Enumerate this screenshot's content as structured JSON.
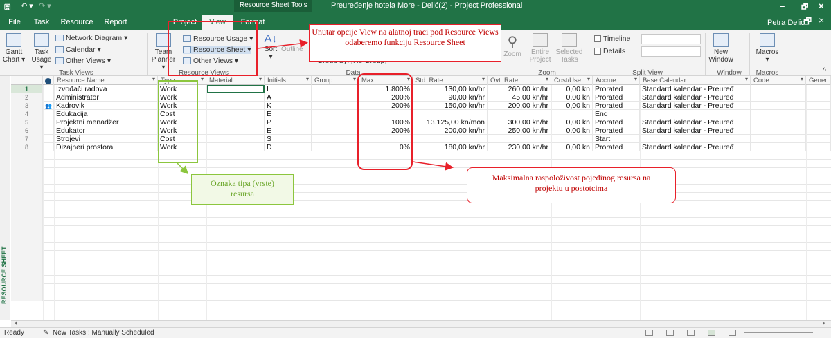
{
  "titlebar": {
    "context_tab": "Resource Sheet Tools",
    "title": "Preuređenje hotela More - Delić(2) - Project Professional",
    "minimize": "–",
    "restore": "🗗",
    "close": "×"
  },
  "tabs": [
    "File",
    "Task",
    "Resource",
    "Report",
    "Project",
    "View",
    "Format"
  ],
  "active_tab": "View",
  "user": "Petra Delic",
  "ribbon": {
    "task_views": {
      "gantt": "Gantt Chart",
      "task_usage": "Task Usage",
      "network_diagram": "Network Diagram",
      "calendar": "Calendar",
      "other_views": "Other Views",
      "label": "Task Views"
    },
    "resource_views": {
      "team_planner": "Team Planner",
      "resource_usage": "Resource Usage",
      "resource_sheet": "Resource Sheet",
      "other_views": "Other Views",
      "label": "Resource Views"
    },
    "data": {
      "sort": "Sort",
      "outline": "Outline",
      "group_by": "Group by: [No Group]",
      "label": "Data"
    },
    "zoom": {
      "zoom": "Zoom",
      "entire_project": "Entire Project",
      "selected_tasks": "Selected Tasks",
      "label": "Zoom"
    },
    "split_view": {
      "timeline": "Timeline",
      "details": "Details",
      "label": "Split View"
    },
    "window": {
      "new_window": "New Window",
      "label": "Window"
    },
    "macros": {
      "macros": "Macros",
      "label": "Macros"
    }
  },
  "side_label": "RESOURCE SHEET",
  "columns": [
    "Resource Name",
    "Type",
    "Material",
    "Initials",
    "Group",
    "Max.",
    "Std. Rate",
    "Ovt. Rate",
    "Cost/Use",
    "Accrue",
    "Base Calendar",
    "Code",
    "Gener"
  ],
  "rows": [
    {
      "num": "1",
      "name": "Izvođači radova",
      "type": "Work",
      "material": "",
      "initials": "I",
      "group": "",
      "max": "1.800%",
      "std": "130,00 kn/hr",
      "ovt": "260,00 kn/hr",
      "cost": "0,00 kn",
      "accrue": "Prorated",
      "cal": "Standard kalendar - Preuređ",
      "indicator": ""
    },
    {
      "num": "2",
      "name": "Administrator",
      "type": "Work",
      "material": "",
      "initials": "A",
      "group": "",
      "max": "200%",
      "std": "90,00 kn/hr",
      "ovt": "45,00 kn/hr",
      "cost": "0,00 kn",
      "accrue": "Prorated",
      "cal": "Standard kalendar - Preuređ",
      "indicator": ""
    },
    {
      "num": "3",
      "name": "Kadrovik",
      "type": "Work",
      "material": "",
      "initials": "K",
      "group": "",
      "max": "200%",
      "std": "150,00 kn/hr",
      "ovt": "200,00 kn/hr",
      "cost": "0,00 kn",
      "accrue": "Prorated",
      "cal": "Standard kalendar - Preuređ",
      "indicator": "people-icon"
    },
    {
      "num": "4",
      "name": "Edukacija",
      "type": "Cost",
      "material": "",
      "initials": "E",
      "group": "",
      "max": "",
      "std": "",
      "ovt": "",
      "cost": "",
      "accrue": "End",
      "cal": "",
      "indicator": ""
    },
    {
      "num": "5",
      "name": "Projektni menadžer",
      "type": "Work",
      "material": "",
      "initials": "P",
      "group": "",
      "max": "100%",
      "std": "13.125,00 kn/mon",
      "ovt": "300,00 kn/hr",
      "cost": "0,00 kn",
      "accrue": "Prorated",
      "cal": "Standard kalendar - Preuređ",
      "indicator": ""
    },
    {
      "num": "6",
      "name": "Edukator",
      "type": "Work",
      "material": "",
      "initials": "E",
      "group": "",
      "max": "200%",
      "std": "200,00 kn/hr",
      "ovt": "250,00 kn/hr",
      "cost": "0,00 kn",
      "accrue": "Prorated",
      "cal": "Standard kalendar - Preuređ",
      "indicator": ""
    },
    {
      "num": "7",
      "name": "Strojevi",
      "type": "Cost",
      "material": "",
      "initials": "S",
      "group": "",
      "max": "",
      "std": "",
      "ovt": "",
      "cost": "",
      "accrue": "Start",
      "cal": "",
      "indicator": ""
    },
    {
      "num": "8",
      "name": "Dizajneri prostora",
      "type": "Work",
      "material": "",
      "initials": "D",
      "group": "",
      "max": "0%",
      "std": "180,00 kn/hr",
      "ovt": "230,00 kn/hr",
      "cost": "0,00 kn",
      "accrue": "Prorated",
      "cal": "Standard kalendar - Preuređ",
      "indicator": ""
    }
  ],
  "annotations": {
    "top": "Unutar opcije View na alatnoj traci pod Resource Views odaberemo funkciju Resource Sheet",
    "type": "Oznaka tipa (vrste) resursa",
    "max": "Maksimalna raspoloživost pojedinog resursa na projektu u postotcima"
  },
  "status": {
    "ready": "Ready",
    "new_tasks": "New Tasks : Manually Scheduled"
  },
  "colors": {
    "accent": "#217346",
    "annotation_red": "#e8202a",
    "annotation_green": "#8cc63e"
  }
}
